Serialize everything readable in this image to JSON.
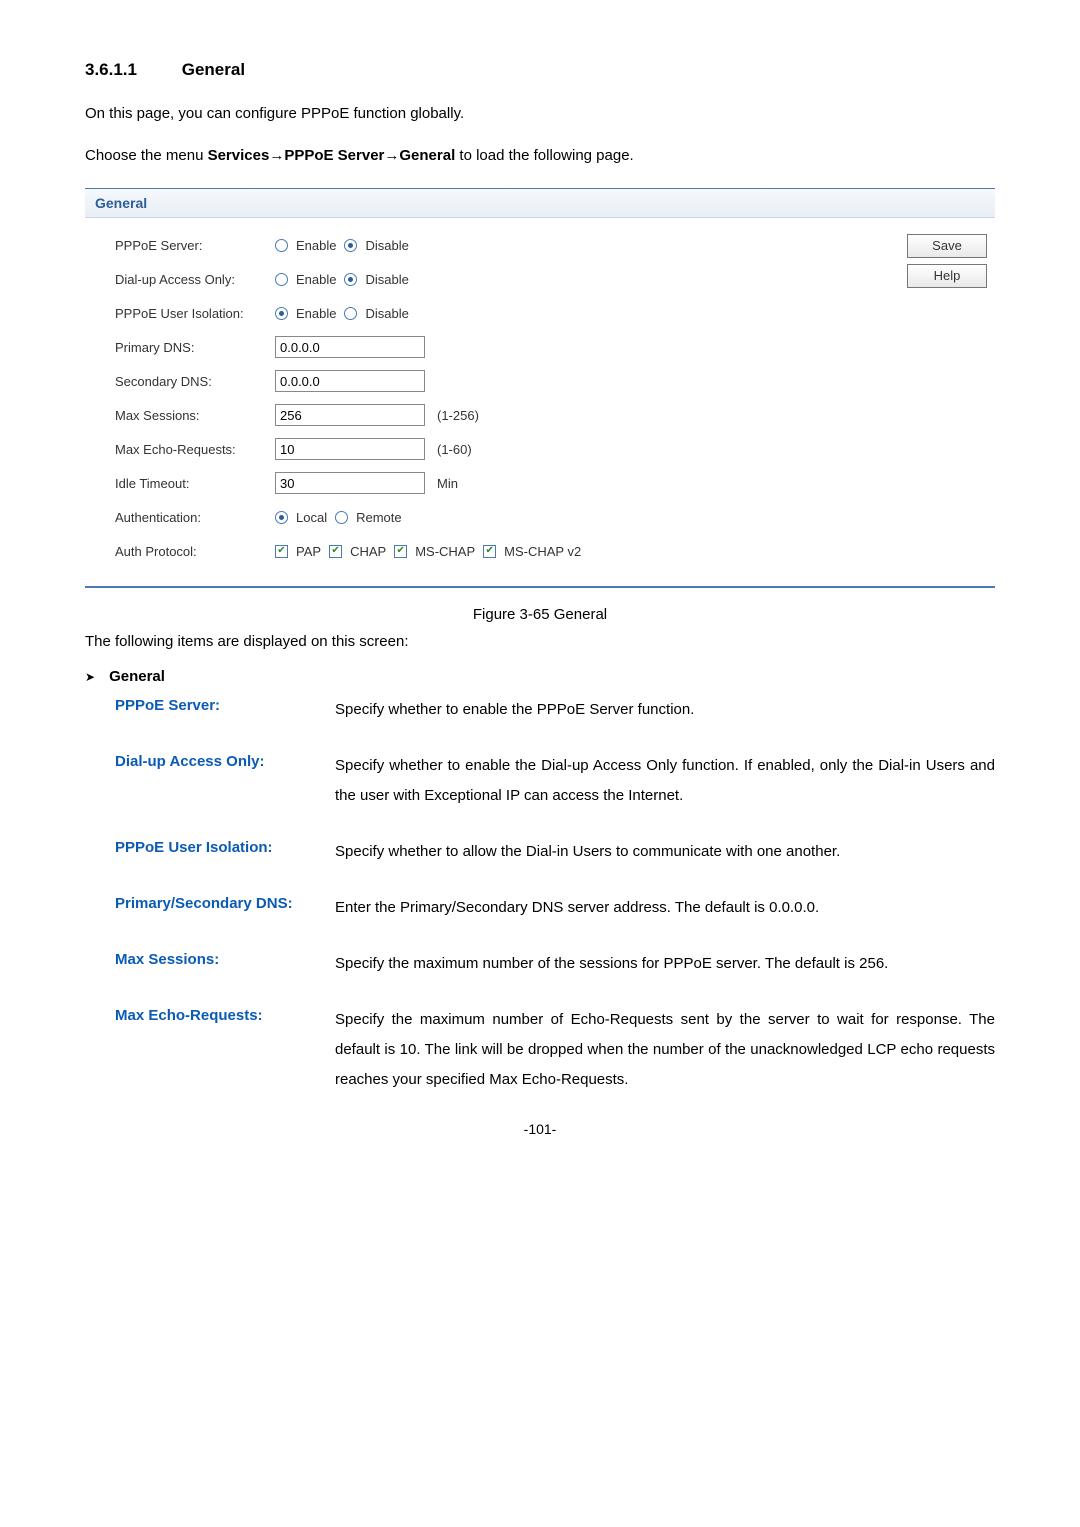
{
  "heading": {
    "number": "3.6.1.1",
    "title": "General"
  },
  "intro": "On this page, you can configure PPPoE function globally.",
  "nav": {
    "prefix": "Choose the menu ",
    "p1": "Services",
    "arrow": "→",
    "p2": "PPPoE Server",
    "p3": "General",
    "suffix": " to load the following page."
  },
  "panel": {
    "title": "General",
    "rows": {
      "pppoe_server": {
        "label": "PPPoE Server:",
        "opt1": "Enable",
        "opt2": "Disable",
        "selected": "Disable"
      },
      "dial_up": {
        "label": "Dial-up Access Only:",
        "opt1": "Enable",
        "opt2": "Disable",
        "selected": "Disable"
      },
      "isolation": {
        "label": "PPPoE User Isolation:",
        "opt1": "Enable",
        "opt2": "Disable",
        "selected": "Enable"
      },
      "primary_dns": {
        "label": "Primary DNS:",
        "value": "0.0.0.0"
      },
      "secondary_dns": {
        "label": "Secondary DNS:",
        "value": "0.0.0.0"
      },
      "max_sessions": {
        "label": "Max Sessions:",
        "value": "256",
        "hint": "(1-256)"
      },
      "max_echo": {
        "label": "Max Echo-Requests:",
        "value": "10",
        "hint": "(1-60)"
      },
      "idle": {
        "label": "Idle Timeout:",
        "value": "30",
        "hint": "Min"
      },
      "auth": {
        "label": "Authentication:",
        "opt1": "Local",
        "opt2": "Remote",
        "selected": "Local"
      },
      "proto": {
        "label": "Auth Protocol:",
        "c1": "PAP",
        "c2": "CHAP",
        "c3": "MS-CHAP",
        "c4": "MS-CHAP v2"
      }
    },
    "buttons": {
      "save": "Save",
      "help": "Help"
    }
  },
  "figure_caption": "Figure 3-65 General",
  "desc_intro": "The following items are displayed on this screen:",
  "bullet_title": "General",
  "descriptions": {
    "pppoe_server": {
      "term": "PPPoE Server:",
      "def": "Specify whether to enable the PPPoE Server function."
    },
    "dial_up": {
      "term": "Dial-up Access Only:",
      "def": "Specify whether to enable the Dial-up Access Only function. If enabled, only the Dial-in Users and the user with Exceptional IP can access the Internet."
    },
    "isolation": {
      "term": "PPPoE User Isolation:",
      "def": "Specify whether to allow the Dial-in Users to communicate with one another."
    },
    "dns": {
      "term": "Primary/Secondary DNS:",
      "def": "Enter the Primary/Secondary DNS server address. The default is 0.0.0.0."
    },
    "max_sessions": {
      "term": "Max Sessions:",
      "def": "Specify the maximum number of the sessions for PPPoE server. The default is 256."
    },
    "max_echo": {
      "term": "Max Echo-Requests:",
      "def": "Specify the maximum number of Echo-Requests sent by the server to wait for response. The default is 10. The link will be dropped when the number of the unacknowledged LCP echo requests reaches your specified Max Echo-Requests."
    }
  },
  "page_number": "-101-"
}
